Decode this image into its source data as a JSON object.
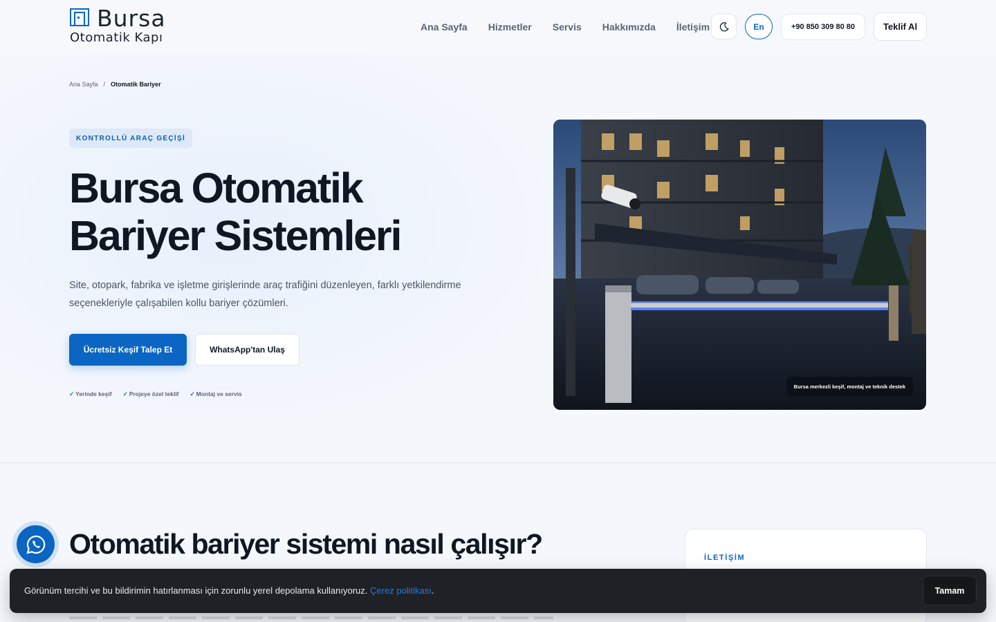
{
  "brand": {
    "name_top": "Bursa",
    "name_bottom": "Otomatik Kapı"
  },
  "nav": {
    "items": [
      "Ana Sayfa",
      "Hizmetler",
      "Servis",
      "Hakkımızda",
      "İletişim"
    ]
  },
  "header": {
    "lang": "En",
    "phone": "+90 850 309 80 80",
    "quote": "Teklif Al",
    "theme_icon": "moon-icon"
  },
  "breadcrumb": {
    "home": "Ana Sayfa",
    "separator": "/",
    "current": "Otomatik Bariyer"
  },
  "hero": {
    "tag": "KONTROLLÜ ARAÇ GEÇİŞİ",
    "title_line1": "Bursa Otomatik",
    "title_line2": "Bariyer Sistemleri",
    "description": "Site, otopark, fabrika ve işletme girişlerinde araç trafiğini düzenleyen, farklı yetkilendirme seçenekleriyle çalışabilen kollu bariyer çözümleri.",
    "primary_cta": "Ücretsiz Keşif Talep Et",
    "secondary_cta": "WhatsApp'tan Ulaş",
    "checks": [
      "Yerinde keşif",
      "Projeye özel teklif",
      "Montaj ve servis"
    ],
    "check_mark": "✓",
    "image_caption": "Bursa merkezli keşif, montaj ve teknik destek"
  },
  "section": {
    "title": "Otomatik bariyer sistemi nasıl çalışır?",
    "side_label": "İLETİŞİM"
  },
  "cookie": {
    "text": "Görünüm tercihi ve bu bildirimin hatırlanması için zorunlu yerel depolama kullanıyoruz.",
    "link": "Çerez politikası",
    "suffix": ".",
    "button": "Tamam"
  },
  "colors": {
    "accent": "#0a66c2",
    "dark": "#0f1722",
    "cookie_bg": "#1e2126"
  }
}
